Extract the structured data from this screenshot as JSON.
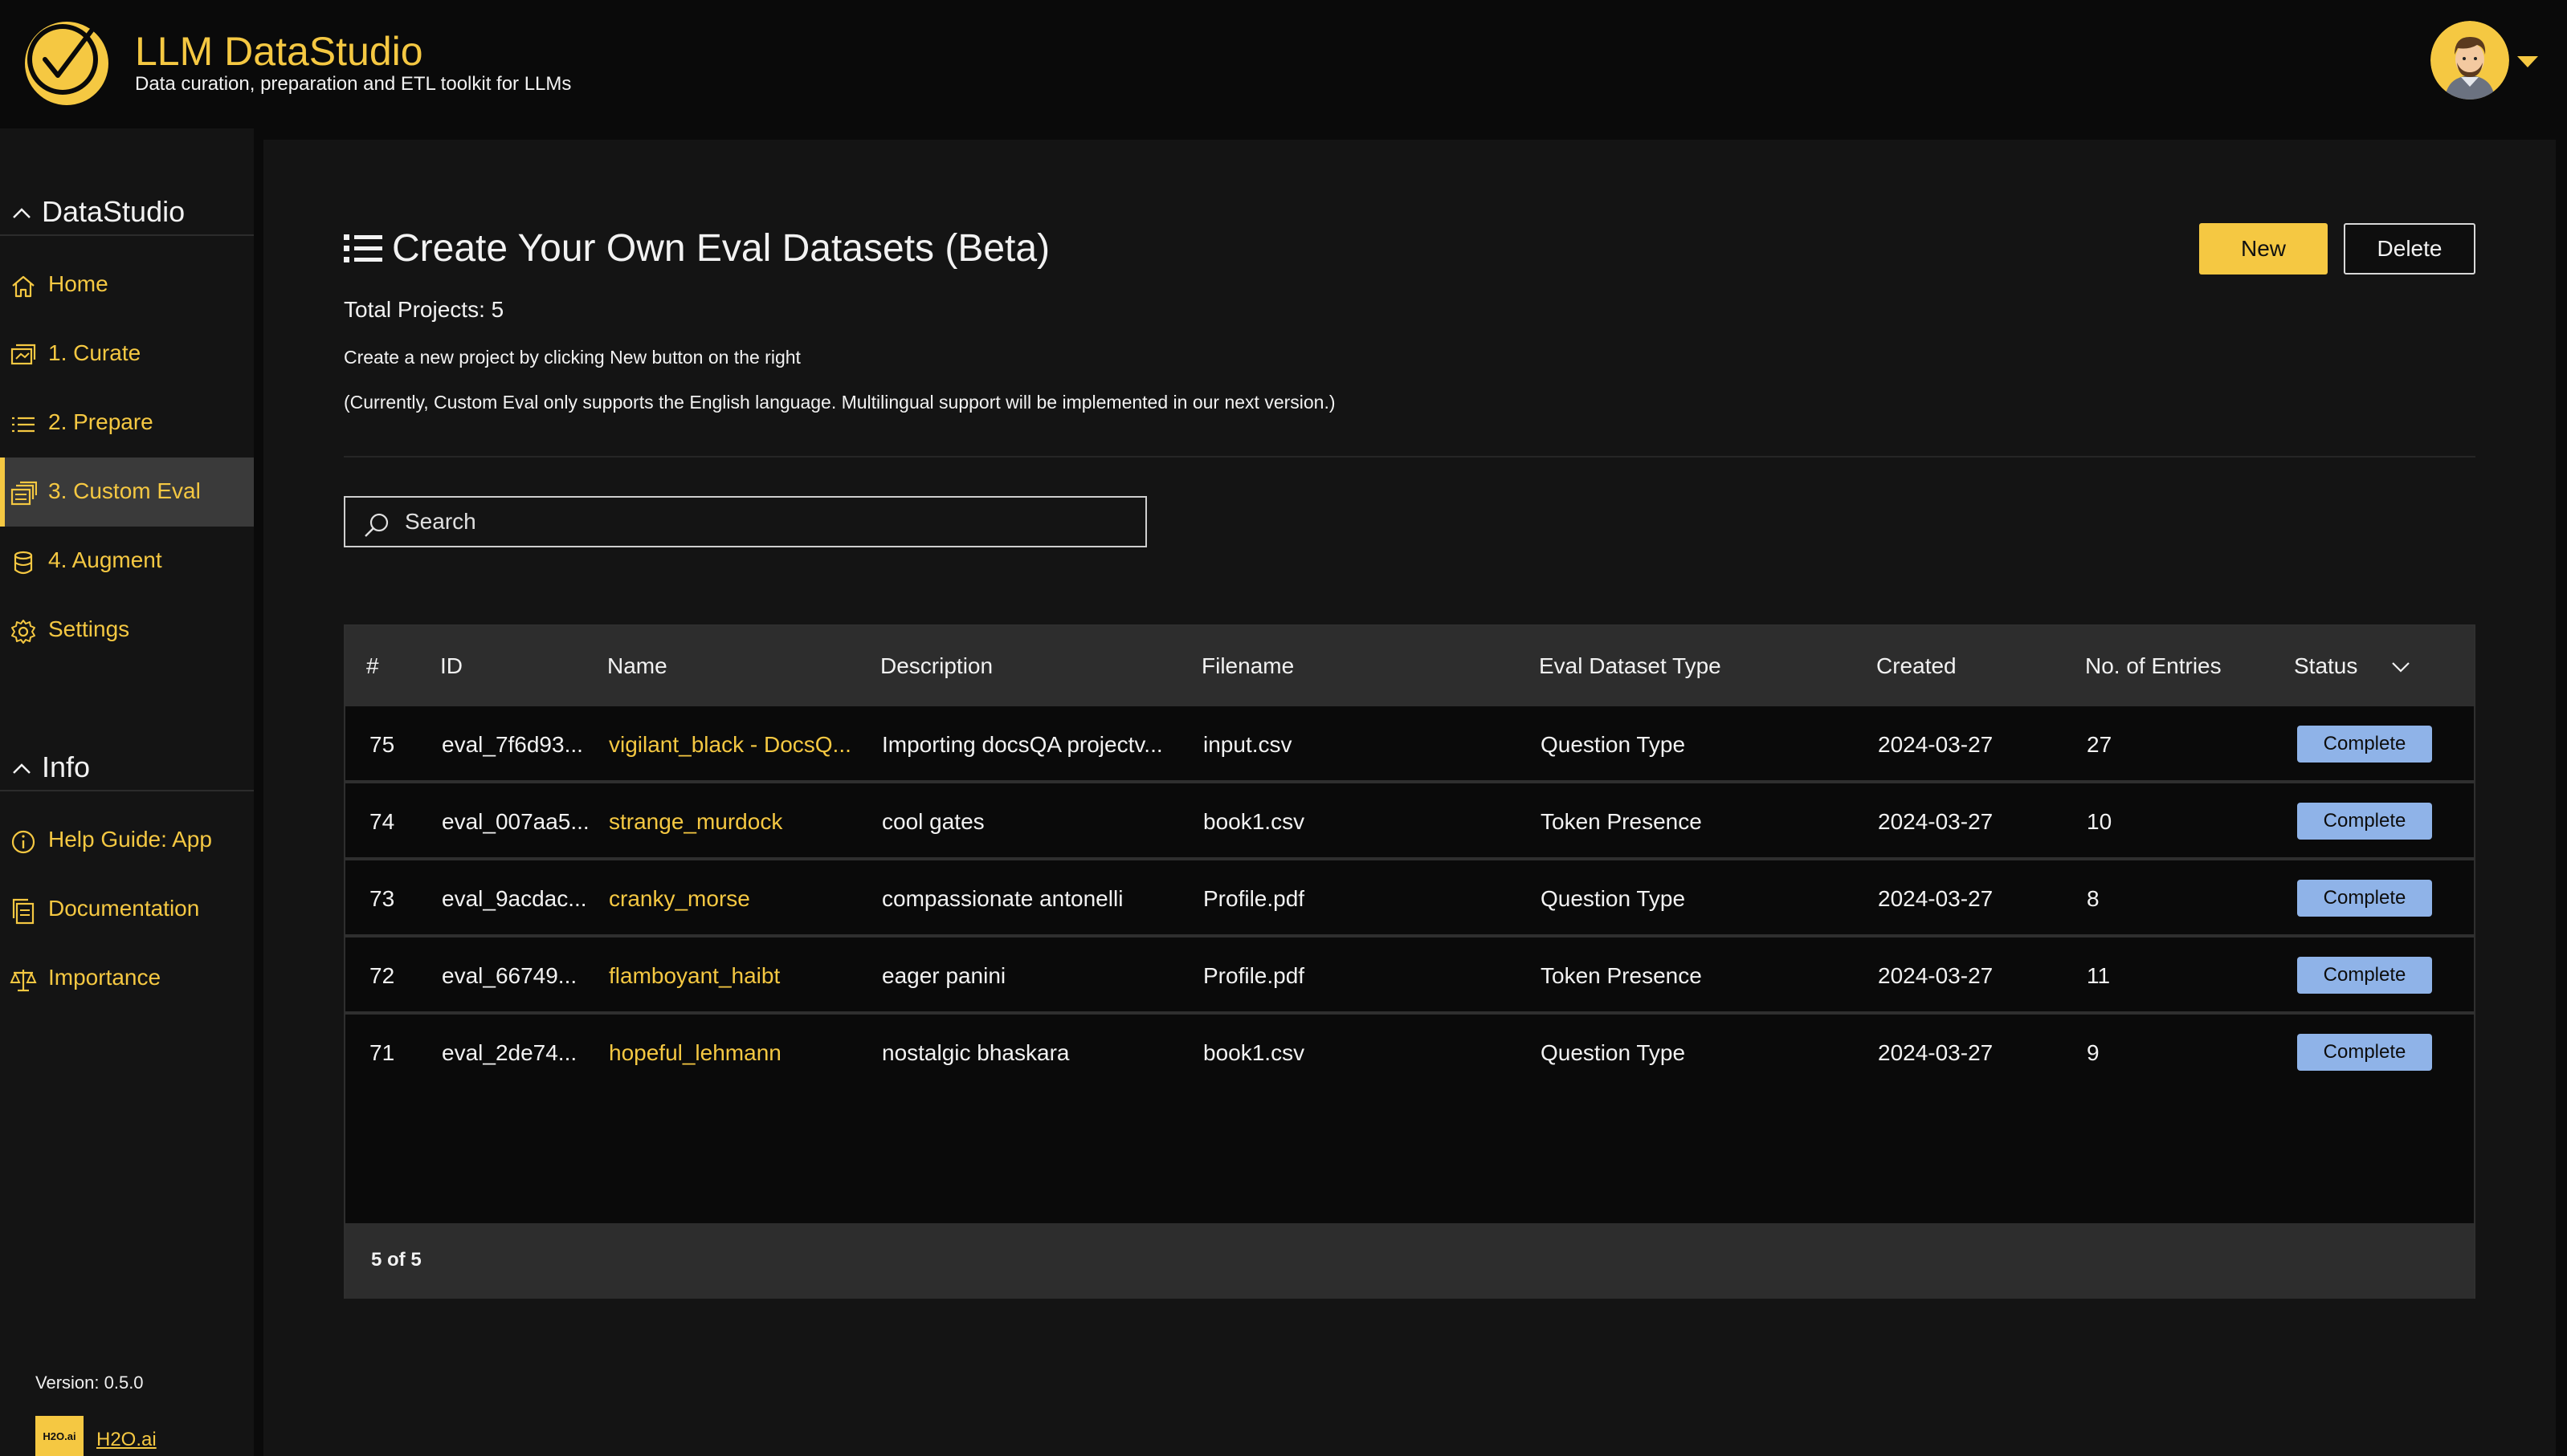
{
  "header": {
    "title": "LLM DataStudio",
    "subtitle": "Data curation, preparation and ETL toolkit for LLMs"
  },
  "colors": {
    "accent": "#f5c842",
    "status_button": "#8fb3e8",
    "background": "#0a0a0a"
  },
  "sidebar": {
    "sections": [
      {
        "label": "DataStudio",
        "items": [
          {
            "label": "Home",
            "icon": "home-icon"
          },
          {
            "label": "1. Curate",
            "icon": "curate-icon"
          },
          {
            "label": "2. Prepare",
            "icon": "list-icon"
          },
          {
            "label": "3. Custom Eval",
            "icon": "stack-icon",
            "active": true
          },
          {
            "label": "4. Augment",
            "icon": "database-icon"
          },
          {
            "label": "Settings",
            "icon": "gear-icon"
          }
        ]
      },
      {
        "label": "Info",
        "items": [
          {
            "label": "Help Guide: App",
            "icon": "info-icon"
          },
          {
            "label": "Documentation",
            "icon": "document-icon"
          },
          {
            "label": "Importance",
            "icon": "scale-icon"
          }
        ]
      }
    ],
    "version": "Version: 0.5.0",
    "brand_logo_text": "H2O.ai",
    "brand_link": "H2O.ai"
  },
  "main": {
    "title": "Create Your Own Eval Datasets (Beta)",
    "new_button": "New",
    "delete_button": "Delete",
    "total_projects": "Total Projects: 5",
    "hint1": "Create a new project by clicking New button on the right",
    "hint2": "(Currently, Custom Eval only supports the English language. Multilingual support will be implemented in our next version.)",
    "search_placeholder": "Search"
  },
  "table": {
    "columns": [
      "#",
      "ID",
      "Name",
      "Description",
      "Filename",
      "Eval Dataset Type",
      "Created",
      "No. of Entries",
      "Status"
    ],
    "rows": [
      {
        "num": "75",
        "id": "eval_7f6d93...",
        "name": "vigilant_black - DocsQ...",
        "description": "Importing docsQA projectv...",
        "filename": "input.csv",
        "type": "Question Type",
        "created": "2024-03-27",
        "entries": "27",
        "status": "Complete"
      },
      {
        "num": "74",
        "id": "eval_007aa5...",
        "name": "strange_murdock",
        "description": "cool gates",
        "filename": "book1.csv",
        "type": "Token Presence",
        "created": "2024-03-27",
        "entries": "10",
        "status": "Complete"
      },
      {
        "num": "73",
        "id": "eval_9acdac...",
        "name": "cranky_morse",
        "description": "compassionate antonelli",
        "filename": "Profile.pdf",
        "type": "Question Type",
        "created": "2024-03-27",
        "entries": "8",
        "status": "Complete"
      },
      {
        "num": "72",
        "id": "eval_66749...",
        "name": "flamboyant_haibt",
        "description": "eager panini",
        "filename": "Profile.pdf",
        "type": "Token Presence",
        "created": "2024-03-27",
        "entries": "11",
        "status": "Complete"
      },
      {
        "num": "71",
        "id": "eval_2de74...",
        "name": "hopeful_lehmann",
        "description": "nostalgic bhaskara",
        "filename": "book1.csv",
        "type": "Question Type",
        "created": "2024-03-27",
        "entries": "9",
        "status": "Complete"
      }
    ],
    "footer": "5 of 5"
  }
}
